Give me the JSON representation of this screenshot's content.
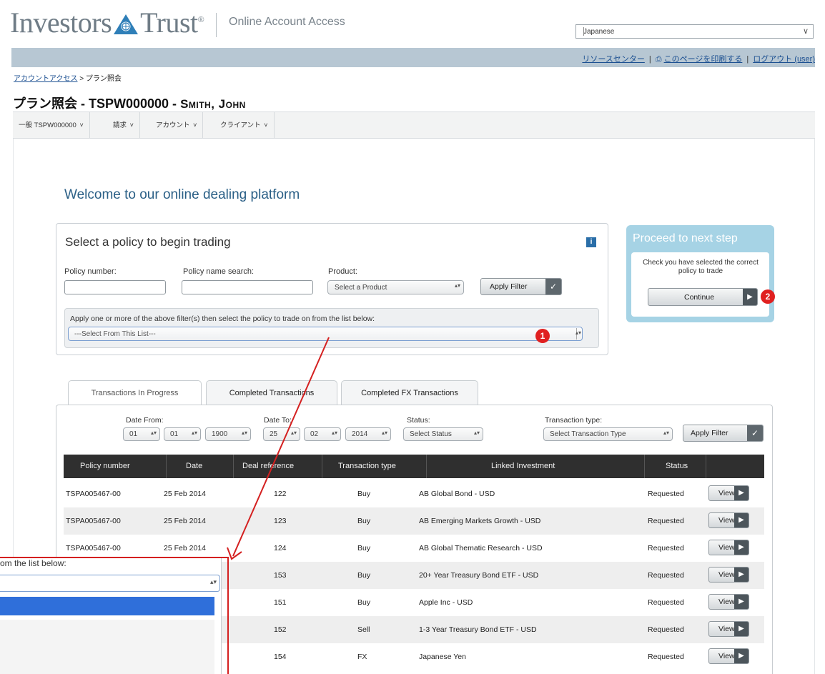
{
  "header": {
    "logo_left": "Investors",
    "logo_right": "Trust",
    "logo_mark": "®",
    "subtitle": "Online Account Access",
    "language": "Japanese",
    "links": [
      "リソースセンター",
      "このページを印刷する",
      "ログアウト (user)"
    ],
    "icon": "print-icon"
  },
  "breadcrumb": {
    "home": "アカウントアクセス",
    "sep": ">",
    "current": "プラン照会"
  },
  "page_title": {
    "prefix": "プラン照会 - TSPW000000 - ",
    "name": "Smith, John"
  },
  "nav": [
    "一般 TSPW000000",
    "請求",
    "アカウント",
    "クライアント"
  ],
  "welcome": "Welcome to our online dealing platform",
  "select_policy": {
    "title": "Select a policy to begin trading",
    "policy_number_label": "Policy number:",
    "policy_name_label": "Policy name search:",
    "product_label": "Product:",
    "product_value": "Select a Product",
    "apply_filter": "Apply Filter",
    "instruction": "Apply one or more of the above filter(s) then select the policy to trade on from the list below:",
    "list_value": "---Select From This List---",
    "badge": "1"
  },
  "proceed": {
    "title": "Proceed to next step",
    "message": "Check you have selected the correct policy to trade",
    "continue": "Continue",
    "badge": "2"
  },
  "tabs": [
    "Transactions In Progress",
    "Completed Transactions",
    "Completed FX Transactions"
  ],
  "filters": {
    "date_from_label": "Date From:",
    "date_to_label": "Date To:",
    "status_label": "Status:",
    "type_label": "Transaction type:",
    "from_day": "01",
    "from_month": "01",
    "from_year": "1900",
    "to_day": "25",
    "to_month": "02",
    "to_year": "2014",
    "status_value": "Select Status",
    "type_value": "Select Transaction Type",
    "apply_filter": "Apply Filter"
  },
  "table": {
    "headers": [
      "Policy number",
      "Date",
      "Deal reference",
      "Transaction type",
      "Linked Investment",
      "Status"
    ],
    "view_label": "View",
    "rows": [
      [
        "TSPA005467-00",
        "25 Feb 2014",
        "122",
        "Buy",
        "AB Global Bond - USD",
        "Requested"
      ],
      [
        "TSPA005467-00",
        "25 Feb 2014",
        "123",
        "Buy",
        "AB Emerging Markets Growth - USD",
        "Requested"
      ],
      [
        "TSPA005467-00",
        "25 Feb 2014",
        "124",
        "Buy",
        "AB Global Thematic Research - USD",
        "Requested"
      ],
      [
        "",
        "",
        "153",
        "Buy",
        "20+ Year Treasury Bond ETF - USD",
        "Requested"
      ],
      [
        "",
        "",
        "151",
        "Buy",
        "Apple Inc - USD",
        "Requested"
      ],
      [
        "",
        "",
        "152",
        "Sell",
        "1-3 Year Treasury Bond ETF - USD",
        "Requested"
      ],
      [
        "",
        "",
        "154",
        "FX",
        "Japanese Yen",
        "Requested"
      ]
    ]
  },
  "zoom_popup": {
    "text": "om the list below:"
  },
  "colors": {
    "accent": "#2a5f86",
    "badge": "#e02020",
    "header_band": "#b7c7d3",
    "proceed": "#a6d3e5",
    "table_head": "#2f2f2f"
  }
}
